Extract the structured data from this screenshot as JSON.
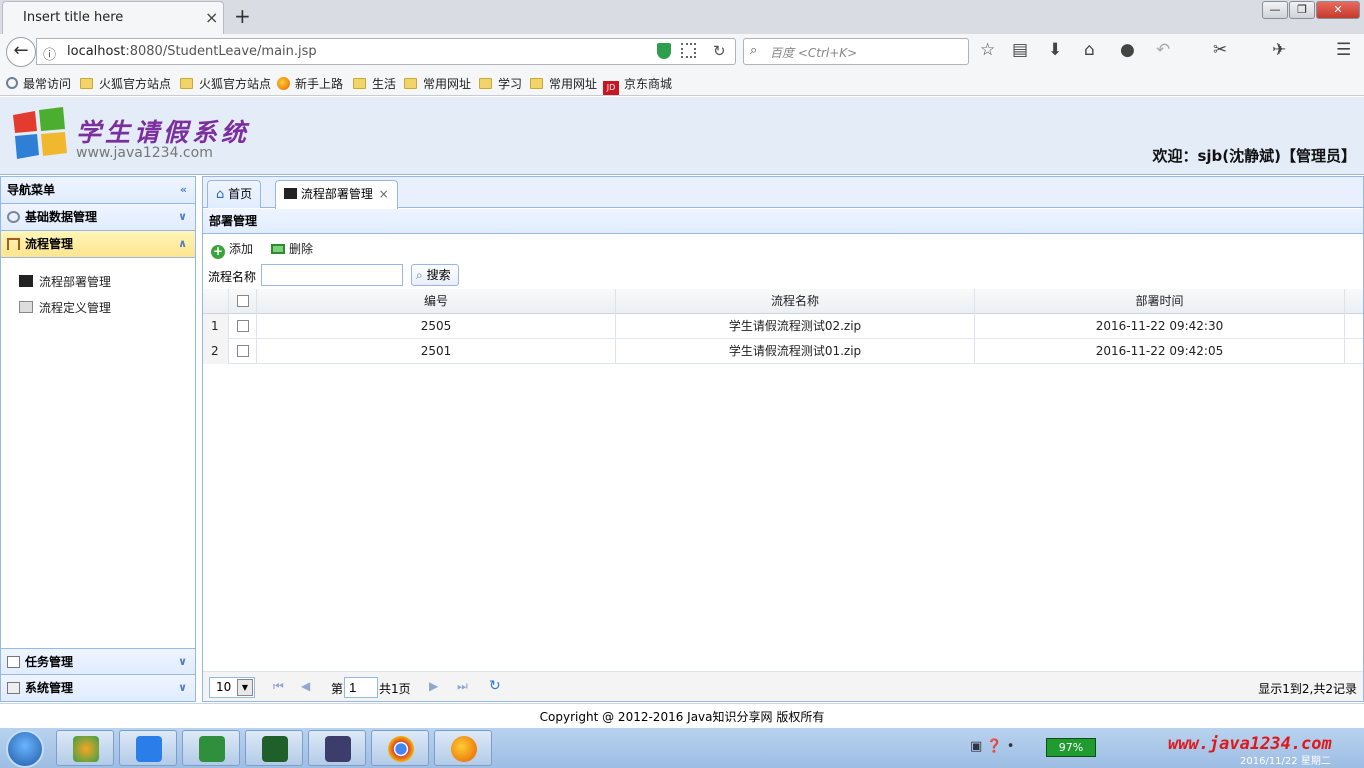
{
  "browser": {
    "tab_title": "Insert title here",
    "tab_close": "×",
    "new_tab": "+",
    "url_host": "localhost",
    "url_rest": ":8080/StudentLeave/main.jsp",
    "search_placeholder": "百度 <Ctrl+K>",
    "window_controls": [
      "minimize",
      "maximize",
      "close"
    ],
    "bookmarks": [
      {
        "label": "最常访问",
        "icon": "gear-icon"
      },
      {
        "label": "火狐官方站点",
        "icon": "folder-icon"
      },
      {
        "label": "火狐官方站点",
        "icon": "folder-icon"
      },
      {
        "label": "新手上路",
        "icon": "firefox-icon"
      },
      {
        "label": "生活",
        "icon": "folder-icon"
      },
      {
        "label": "常用网址",
        "icon": "folder-icon"
      },
      {
        "label": "学习",
        "icon": "folder-icon"
      },
      {
        "label": "常用网址",
        "icon": "folder-icon"
      },
      {
        "label": "京东商城",
        "icon": "jd-icon"
      }
    ]
  },
  "header": {
    "logo_title": "学生请假系统",
    "logo_subtitle": "www.java1234.com",
    "welcome": "欢迎：sjb(沈静斌)【管理员】"
  },
  "sidebar": {
    "title": "导航菜单",
    "sections": [
      {
        "label": "基础数据管理",
        "icon": "gear-icon",
        "expanded": false
      },
      {
        "label": "流程管理",
        "icon": "org-chart-icon",
        "expanded": true
      },
      {
        "label": "任务管理",
        "icon": "edit-icon",
        "expanded": false
      },
      {
        "label": "系统管理",
        "icon": "settings-icon",
        "expanded": false
      }
    ],
    "flow_items": [
      {
        "label": "流程部署管理",
        "icon": "clapper-icon"
      },
      {
        "label": "流程定义管理",
        "icon": "document-icon"
      }
    ]
  },
  "main": {
    "tabs": [
      {
        "label": "首页",
        "icon": "home-icon"
      },
      {
        "label": "流程部署管理",
        "icon": "clapper-icon",
        "active": true,
        "close": "×"
      }
    ],
    "panel_title": "部署管理",
    "toolbar": {
      "add_label": "添加",
      "delete_label": "删除"
    },
    "search": {
      "label": "流程名称",
      "value": "",
      "button_label": "搜索"
    },
    "grid": {
      "columns": [
        "编号",
        "流程名称",
        "部署时间"
      ],
      "rows": [
        {
          "num": "1",
          "id": "2505",
          "name": "学生请假流程测试02.zip",
          "time": "2016-11-22 09:42:30"
        },
        {
          "num": "2",
          "id": "2501",
          "name": "学生请假流程测试01.zip",
          "time": "2016-11-22 09:42:05"
        }
      ]
    },
    "pager": {
      "page_size": "10",
      "page_prefix": "第",
      "page_value": "1",
      "page_total": "共1页",
      "info": "显示1到2,共2记录"
    }
  },
  "footer": {
    "copyright": "Copyright @ 2012-2016 Java知识分享网 版权所有"
  },
  "taskbar": {
    "battery": "97%",
    "watermark": "www.java1234.com",
    "date": "2016/11/22 星期二"
  },
  "colors": {
    "accent_border": "#95b8e7",
    "header_bg": "#e4ecf8",
    "active_section": "#ffe48d",
    "logo_title": "#7b2e9e"
  }
}
